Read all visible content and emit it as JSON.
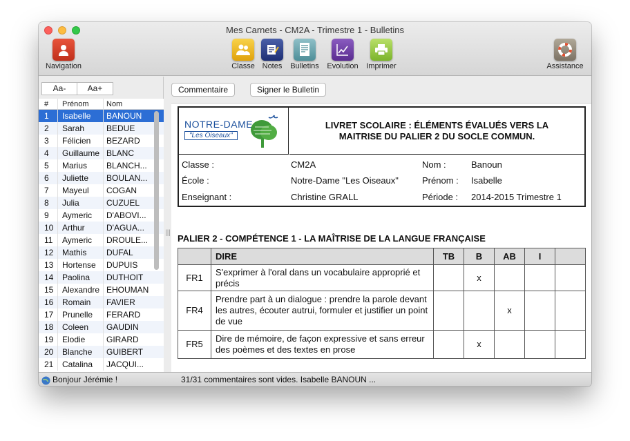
{
  "window": {
    "title": "Mes Carnets - CM2A - Trimestre 1 - Bulletins"
  },
  "toolbar": {
    "navigation": "Navigation",
    "classe": "Classe",
    "notes": "Notes",
    "bulletins": "Bulletins",
    "evolution": "Evolution",
    "imprimer": "Imprimer",
    "assistance": "Assistance"
  },
  "sidebar": {
    "font_decrease": "Aa-",
    "font_increase": "Aa+",
    "columns": {
      "num": "#",
      "prenom": "Prénom",
      "nom": "Nom"
    },
    "students": [
      {
        "num": "1",
        "prenom": "Isabelle",
        "nom": "BANOUN"
      },
      {
        "num": "2",
        "prenom": "Sarah",
        "nom": "BEDUE"
      },
      {
        "num": "3",
        "prenom": "Félicien",
        "nom": "BEZARD"
      },
      {
        "num": "4",
        "prenom": "Guillaume",
        "nom": "BLANC"
      },
      {
        "num": "5",
        "prenom": "Marius",
        "nom": "BLANCH..."
      },
      {
        "num": "6",
        "prenom": "Juliette",
        "nom": "BOULAN..."
      },
      {
        "num": "7",
        "prenom": "Mayeul",
        "nom": "COGAN"
      },
      {
        "num": "8",
        "prenom": "Julia",
        "nom": "CUZUEL"
      },
      {
        "num": "9",
        "prenom": "Aymeric",
        "nom": "D'ABOVI..."
      },
      {
        "num": "10",
        "prenom": "Arthur",
        "nom": "D'AGUA..."
      },
      {
        "num": "11",
        "prenom": "Aymeric",
        "nom": "DROULE..."
      },
      {
        "num": "12",
        "prenom": "Mathis",
        "nom": "DUFAL"
      },
      {
        "num": "13",
        "prenom": "Hortense",
        "nom": "DUPUIS"
      },
      {
        "num": "14",
        "prenom": "Paolina",
        "nom": "DUTHOIT"
      },
      {
        "num": "15",
        "prenom": "Alexandre",
        "nom": "EHOUMAN"
      },
      {
        "num": "16",
        "prenom": "Romain",
        "nom": "FAVIER"
      },
      {
        "num": "17",
        "prenom": "Prunelle",
        "nom": "FERARD"
      },
      {
        "num": "18",
        "prenom": "Coleen",
        "nom": "GAUDIN"
      },
      {
        "num": "19",
        "prenom": "Elodie",
        "nom": "GIRARD"
      },
      {
        "num": "20",
        "prenom": "Blanche",
        "nom": "GUIBERT"
      },
      {
        "num": "21",
        "prenom": "Catalina",
        "nom": "JACQUI..."
      }
    ]
  },
  "actions": {
    "commentaire": "Commentaire",
    "signer": "Signer le Bulletin"
  },
  "document": {
    "logo_line1": "NOTRE-DAME",
    "logo_line2": "\"Les Oiseaux\"",
    "header_title": "LIVRET SCOLAIRE : ÉLÉMENTS ÉVALUÉS VERS LA MAITRISE DU PALIER 2 DU SOCLE COMMUN.",
    "info": {
      "classe_label": "Classe :",
      "classe_value": "CM2A",
      "ecole_label": "École :",
      "ecole_value": "Notre-Dame \"Les Oiseaux\"",
      "enseignant_label": "Enseignant :",
      "enseignant_value": "Christine GRALL",
      "nom_label": "Nom :",
      "nom_value": "Banoun",
      "prenom_label": "Prénom :",
      "prenom_value": "Isabelle",
      "periode_label": "Période :",
      "periode_value": "2014-2015 Trimestre 1"
    },
    "section_title": "PALIER 2 - COMPÉTENCE 1 - LA MAÎTRISE DE LA LANGUE FRANÇAISE",
    "table_headers": {
      "dire": "DIRE",
      "tb": "TB",
      "b": "B",
      "ab": "AB",
      "i": "I"
    },
    "rows": [
      {
        "code": "FR1",
        "text": "S'exprimer à l'oral dans un vocabulaire approprié et précis",
        "tb": "",
        "b": "x",
        "ab": "",
        "i": ""
      },
      {
        "code": "FR4",
        "text": "Prendre part à un dialogue : prendre la parole devant les autres, écouter autrui, formuler et justifier un point de vue",
        "tb": "",
        "b": "",
        "ab": "x",
        "i": ""
      },
      {
        "code": "FR5",
        "text": "Dire de mémoire, de façon expressive et sans erreur des poèmes et des textes en prose",
        "tb": "",
        "b": "x",
        "ab": "",
        "i": ""
      }
    ]
  },
  "status": {
    "greeting": "Bonjour Jérémie !",
    "message": "31/31 commentaires sont vides. Isabelle BANOUN ..."
  }
}
